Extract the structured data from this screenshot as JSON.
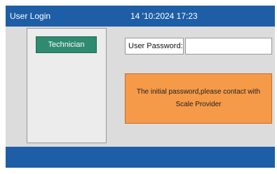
{
  "titlebar": {
    "title": "User Login",
    "datetime": "14 '10:2024 17:23"
  },
  "users": {
    "items": [
      {
        "label": "Technician"
      }
    ]
  },
  "login": {
    "password_label": "User Password:",
    "password_value": "",
    "password_placeholder": ""
  },
  "notice": {
    "text": "The initial password,please contact with Scale Provider"
  },
  "colors": {
    "titlebar": "#1e5ea6",
    "background": "#dcdcdc",
    "user_button": "#2e8b6f",
    "notice": "#f59a48"
  }
}
